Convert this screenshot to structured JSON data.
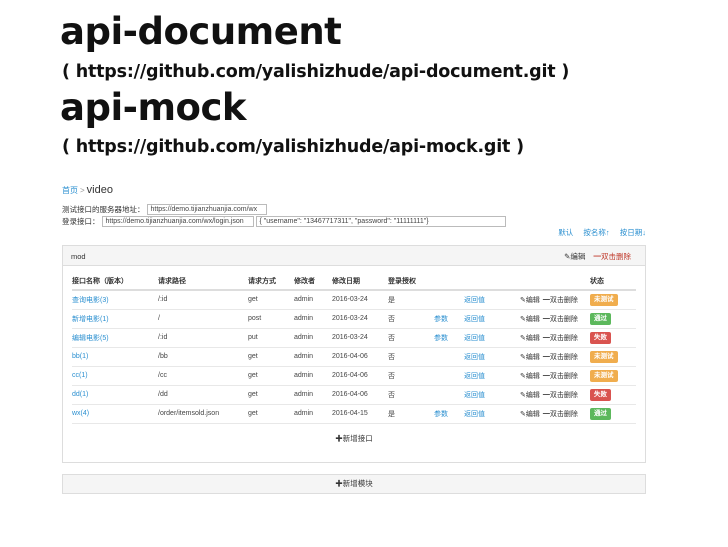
{
  "heading": {
    "title1": "api-document",
    "link1": "( https://github.com/yalishizhude/api-document.git )",
    "title2": "api-mock",
    "link2": "( https://github.com/yalishizhude/api-mock.git )"
  },
  "app": {
    "breadcrumb": {
      "home": "首页",
      "sep": ">",
      "current": "video"
    },
    "server": {
      "label": "测试接口的服务器地址：",
      "value": "https://demo.tijianzhuanjia.com/wx"
    },
    "login": {
      "label": "登录接口：",
      "url": "https://demo.tijianzhuanjia.com/wx/login.json",
      "body": "{ \"username\": \"13467717311\", \"password\": \"11111111\"}"
    },
    "sort": [
      "默认",
      "按名称↑",
      "按日期↓"
    ],
    "module": {
      "name": "mod",
      "edit": "✎编辑",
      "delete": "━双击删除",
      "columns": [
        "接口名称（版本）",
        "请求路径",
        "请求方式",
        "修改者",
        "修改日期",
        "登录授权",
        "",
        "",
        "",
        "状态"
      ],
      "rows": [
        {
          "name": "查询电影(3)",
          "path": "/:id",
          "method": "get",
          "user": "admin",
          "date": "2016-03-24",
          "auth": "是",
          "params": "",
          "ret": "返回值",
          "edit": "✎编辑",
          "del": "━双击删除",
          "status": "未测试",
          "color": "#f0ad4e"
        },
        {
          "name": "新增电影(1)",
          "path": "/",
          "method": "post",
          "user": "admin",
          "date": "2016-03-24",
          "auth": "否",
          "params": "参数",
          "ret": "返回值",
          "edit": "✎编辑",
          "del": "━双击删除",
          "status": "通过",
          "color": "#5cb85c"
        },
        {
          "name": "编辑电影(5)",
          "path": "/:id",
          "method": "put",
          "user": "admin",
          "date": "2016-03-24",
          "auth": "否",
          "params": "参数",
          "ret": "返回值",
          "edit": "✎编辑",
          "del": "━双击删除",
          "status": "失败",
          "color": "#d9534f"
        },
        {
          "name": "bb(1)",
          "path": "/bb",
          "method": "get",
          "user": "admin",
          "date": "2016-04-06",
          "auth": "否",
          "params": "",
          "ret": "返回值",
          "edit": "✎编辑",
          "del": "━双击删除",
          "status": "未测试",
          "color": "#f0ad4e"
        },
        {
          "name": "cc(1)",
          "path": "/cc",
          "method": "get",
          "user": "admin",
          "date": "2016-04-06",
          "auth": "否",
          "params": "",
          "ret": "返回值",
          "edit": "✎编辑",
          "del": "━双击删除",
          "status": "未测试",
          "color": "#f0ad4e"
        },
        {
          "name": "dd(1)",
          "path": "/dd",
          "method": "get",
          "user": "admin",
          "date": "2016-04-06",
          "auth": "否",
          "params": "",
          "ret": "返回值",
          "edit": "✎编辑",
          "del": "━双击删除",
          "status": "失败",
          "color": "#d9534f"
        },
        {
          "name": "wx(4)",
          "path": "/order/itemsold.json",
          "method": "get",
          "user": "admin",
          "date": "2016-04-15",
          "auth": "是",
          "params": "参数",
          "ret": "返回值",
          "edit": "✎编辑",
          "del": "━双击删除",
          "status": "通过",
          "color": "#5cb85c"
        }
      ],
      "add_interface": "✚新增接口"
    },
    "add_module": "✚新增模块"
  }
}
